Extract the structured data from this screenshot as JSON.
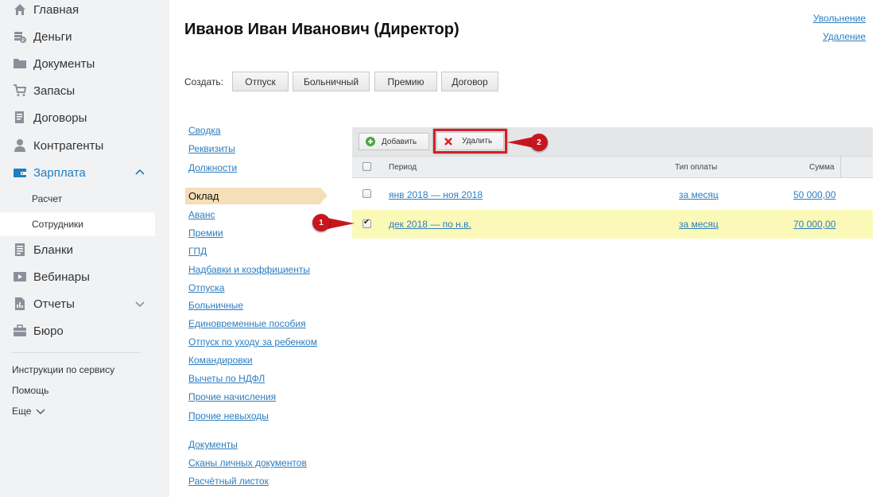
{
  "sidebar": {
    "items": [
      {
        "label": "Главная",
        "icon": "home-icon"
      },
      {
        "label": "Деньги",
        "icon": "wallet-icon"
      },
      {
        "label": "Документы",
        "icon": "documents-icon"
      },
      {
        "label": "Запасы",
        "icon": "cart-icon"
      },
      {
        "label": "Договоры",
        "icon": "contract-icon"
      },
      {
        "label": "Контрагенты",
        "icon": "person-icon"
      },
      {
        "label": "Зарплата",
        "icon": "salary-icon"
      },
      {
        "label": "Бланки",
        "icon": "forms-icon"
      },
      {
        "label": "Вебинары",
        "icon": "webinar-icon"
      },
      {
        "label": "Отчеты",
        "icon": "reports-icon"
      },
      {
        "label": "Бюро",
        "icon": "bureau-icon"
      }
    ],
    "salary_sub": [
      {
        "label": "Расчет"
      },
      {
        "label": "Сотрудники"
      }
    ],
    "bottom_links": {
      "instructions": "Инструкции по сервису",
      "help": "Помощь",
      "more": "Еще"
    }
  },
  "header": {
    "title": "Иванов Иван Иванович (Директор)",
    "dismissal": "Увольнение",
    "delete": "Удаление"
  },
  "create": {
    "label": "Создать:",
    "buttons": [
      "Отпуск",
      "Больничный",
      "Премию",
      "Договор"
    ]
  },
  "sections": {
    "group1": [
      "Сводка",
      "Реквизиты",
      "Должности"
    ],
    "active": "Оклад",
    "group2": [
      "Аванс",
      "Премии",
      "ГПД",
      "Надбавки и коэффициенты",
      "Отпуска",
      "Больничные",
      "Единовременные пособия",
      "Отпуск по уходу за ребенком",
      "Командировки",
      "Вычеты по НДФЛ",
      "Прочие начисления",
      "Прочие невыходы"
    ],
    "group3": [
      "Документы",
      "Сканы личных документов",
      "Расчётный листок"
    ]
  },
  "table": {
    "toolbar": {
      "add": "Добавить",
      "delete": "Удалить"
    },
    "columns": {
      "period": "Период",
      "pay_type": "Тип оплаты",
      "amount": "Сумма"
    },
    "rows": [
      {
        "period": "янв 2018 — ноя 2018",
        "pay_type": "за месяц",
        "amount": "50 000,00",
        "checked": false
      },
      {
        "period": "дек 2018 — по н.в.",
        "pay_type": "за месяц",
        "amount": "70 000,00",
        "checked": true
      }
    ]
  },
  "callouts": [
    "1",
    "2"
  ],
  "colors": {
    "sidebar_bg": "#f1f2f4",
    "accent": "#1f7ec1",
    "link": "#2d7dbf",
    "active_section": "#f5deb8",
    "selected_row": "#fbf9b7",
    "callout": "#c8161e"
  }
}
